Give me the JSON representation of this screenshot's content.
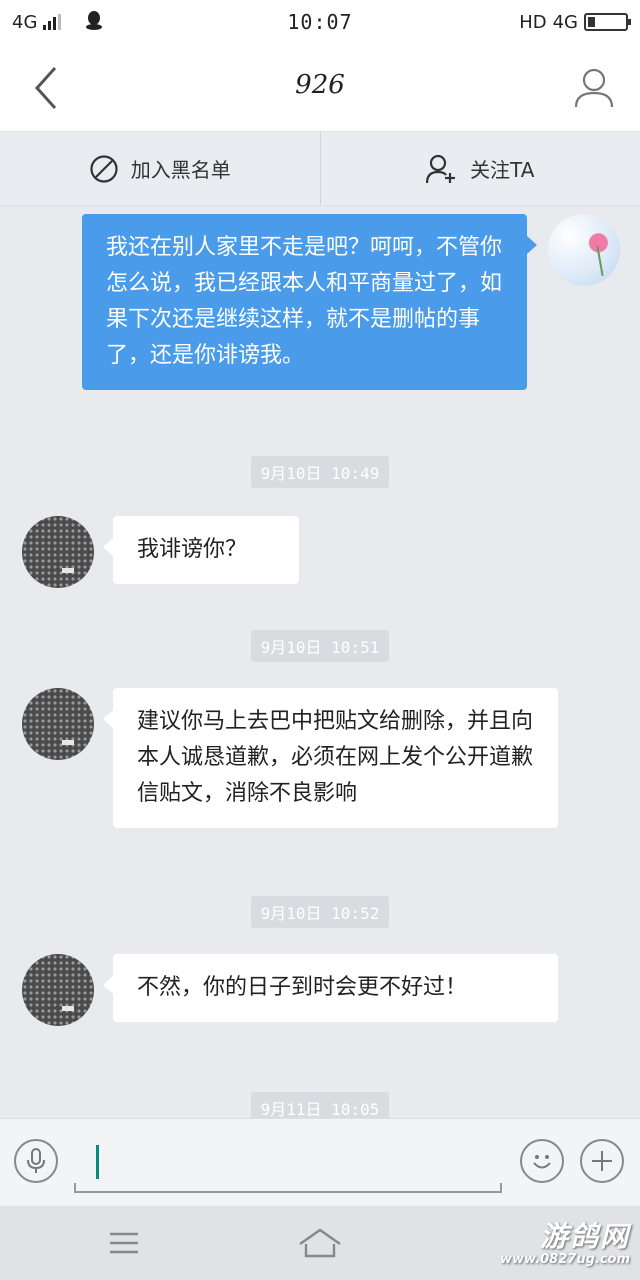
{
  "status_bar": {
    "network_left": "4G",
    "time": "10:07",
    "hd": "HD",
    "network_right": "4G"
  },
  "header": {
    "title": "926",
    "back_icon": "chevron-left-icon",
    "profile_icon": "user-icon"
  },
  "actions": {
    "block_label": "加入黑名单",
    "block_icon": "block-icon",
    "follow_label": "关注TA",
    "follow_icon": "add-user-icon"
  },
  "messages": [
    {
      "direction": "out",
      "text": "我还在别人家里不走是吧？呵呵，不管你怎么说，我已经跟本人和平商量过了，如果下次还是继续这样，就不是删帖的事了，还是你诽谤我。"
    },
    {
      "timestamp": "9月10日 10:49"
    },
    {
      "direction": "in",
      "text": "我诽谤你？"
    },
    {
      "timestamp": "9月10日 10:51"
    },
    {
      "direction": "in",
      "text": "建议你马上去巴中把贴文给删除，并且向本人诚恳道歉，必须在网上发个公开道歉信贴文，消除不良影响"
    },
    {
      "timestamp": "9月10日 10:52"
    },
    {
      "direction": "in",
      "text": "不然，你的日子到时会更不好过！"
    },
    {
      "timestamp": "9月11日 10:05"
    }
  ],
  "input_bar": {
    "voice_icon": "microphone-icon",
    "emoji_icon": "smiley-icon",
    "plus_icon": "plus-icon",
    "value": ""
  },
  "nav_bar": {
    "menu_icon": "menu-icon",
    "home_icon": "home-icon"
  },
  "watermark": {
    "title": "游鸽网",
    "url": "www.0827ug.com"
  }
}
